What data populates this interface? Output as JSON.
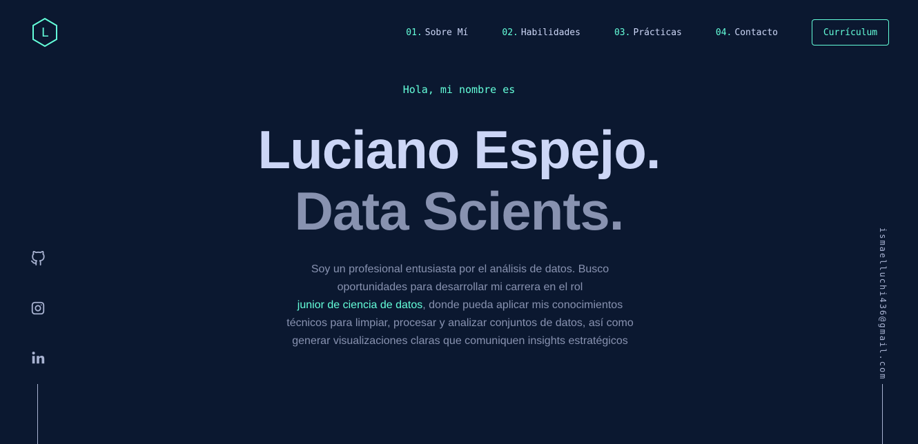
{
  "logo": {
    "letter": "L",
    "icon": "hexagon-logo-icon"
  },
  "nav": {
    "items": [
      {
        "num": "01.",
        "label": "Sobre Mí"
      },
      {
        "num": "02.",
        "label": "Habilidades"
      },
      {
        "num": "03.",
        "label": "Prácticas"
      },
      {
        "num": "04.",
        "label": "Contacto"
      }
    ],
    "resume_label": "Currículum"
  },
  "hero": {
    "greeting": "Hola, mi nombre es",
    "name": "Luciano Espejo.",
    "role": "Data Scients.",
    "bio_lines": [
      "Soy un profesional entusiasta por el análisis de datos. Busco",
      "oportunidades para desarrollar mi carrera en el rol"
    ],
    "bio_highlight": "junior de ciencia de datos",
    "bio_after_highlight": ", donde pueda aplicar mis conocimientos",
    "bio_tail_lines": [
      "técnicos para limpiar, procesar y analizar conjuntos de datos, así como",
      "generar visualizaciones claras que comuniquen insights estratégicos"
    ]
  },
  "social": [
    {
      "icon": "github-icon"
    },
    {
      "icon": "instagram-icon"
    },
    {
      "icon": "linkedin-icon"
    }
  ],
  "email": "ismaelluchi436@gmail.com",
  "colors": {
    "background": "#0b1830",
    "accent": "#64ffda",
    "text_light": "#ccd6f6",
    "text_slate": "#8892b0"
  }
}
